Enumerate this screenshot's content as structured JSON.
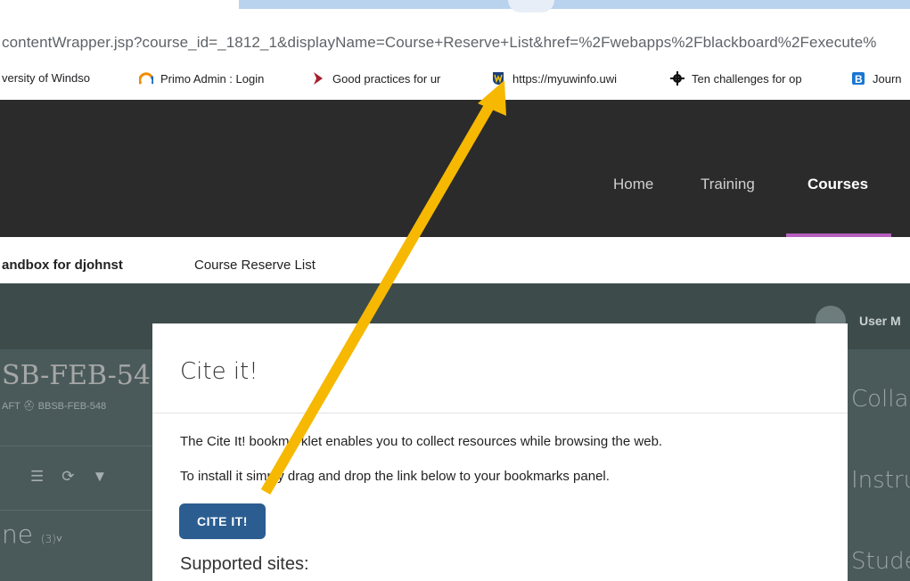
{
  "browser": {
    "url": "contentWrapper.jsp?course_id=_1812_1&displayName=Course+Reserve+List&href=%2Fwebapps%2Fblackboard%2Fexecute%",
    "bookmarks": [
      {
        "label": "versity of Windso",
        "icon": "university-icon"
      },
      {
        "label": "Primo Admin : Login",
        "icon": "primo-icon"
      },
      {
        "label": "Good practices for ur",
        "icon": "chevron-bookmark-icon"
      },
      {
        "label": "https://myuwinfo.uwi",
        "icon": "uwindsor-shield-icon"
      },
      {
        "label": "Ten challenges for op",
        "icon": "gear-cluster-icon"
      },
      {
        "label": "Journ",
        "icon": "b-icon"
      }
    ]
  },
  "nav": {
    "links": [
      "Home",
      "Training",
      "Courses"
    ],
    "active": "Courses",
    "accent_color": "#b65fbf"
  },
  "breadcrumb": [
    "andbox for djohnst",
    "Course Reserve List"
  ],
  "course": {
    "title": "SB-FEB-54",
    "meta": "AFT  ⛑ BBSB-FEB-548",
    "outline_title": "ne",
    "outline_count": "(3)˅",
    "user_menu": "User M",
    "right_labels": [
      "Colla",
      "Instru",
      "Stude"
    ]
  },
  "modal": {
    "title": "Cite it!",
    "p1": "The Cite It! bookmarklet enables you to collect resources while browsing the web.",
    "p2": "To install it simply drag and drop the link below to your bookmarks panel.",
    "button": "CITE IT!",
    "supported": "Supported sites:",
    "button_color": "#2b5d91"
  },
  "annotation": {
    "arrow_color": "#f6b800"
  }
}
